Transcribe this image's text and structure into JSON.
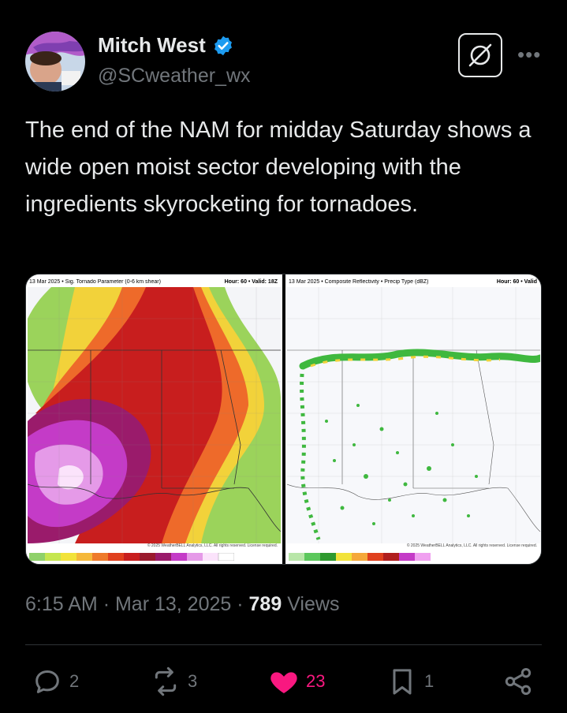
{
  "author": {
    "name": "Mitch West",
    "handle": "@SCweather_wx"
  },
  "tweet": {
    "text": "The end of the NAM for midday Saturday shows a wide open moist sector developing with the ingredients skyrocketing for tornadoes."
  },
  "media": {
    "left_map": {
      "title": "13 Mar 2025 • Sig. Tornado Parameter (0-6 km shear)",
      "hour": "Hour: 60 • Valid: 18Z",
      "scale_labels": [
        "0.5",
        "0.6",
        "0.8",
        "1",
        "1.2",
        "1.6",
        "2",
        "2.4",
        "2.8",
        "3.2",
        "3.6",
        "4",
        "4.5",
        "5",
        "5.5",
        "6",
        "6.5",
        "7",
        "8",
        "9",
        "10"
      ],
      "copyright": "© 2025 WeatherBELL Analytics, LLC. All rights reserved. License required."
    },
    "right_map": {
      "title": "13 Mar 2025 • Composite Reflectivity • Precip Type (dBZ)",
      "hour": "Hour: 60 • Valid",
      "copyright": "© 2025 WeatherBELL Analytics, LLC. All rights reserved. License required."
    }
  },
  "meta": {
    "time": "6:15 AM",
    "date": "Mar 13, 2025",
    "views_count": "789",
    "views_label": "Views"
  },
  "actions": {
    "replies": "2",
    "reposts": "3",
    "likes": "23",
    "bookmarks": "1"
  },
  "colors": {
    "background": "#000000",
    "text": "#e7e9ea",
    "muted": "#71767b",
    "verified": "#1d9bf0",
    "like": "#f91880"
  },
  "icons": [
    "verified-badge-icon",
    "grok-icon",
    "more-icon",
    "reply-icon",
    "repost-icon",
    "heart-icon",
    "bookmark-icon",
    "share-icon"
  ]
}
